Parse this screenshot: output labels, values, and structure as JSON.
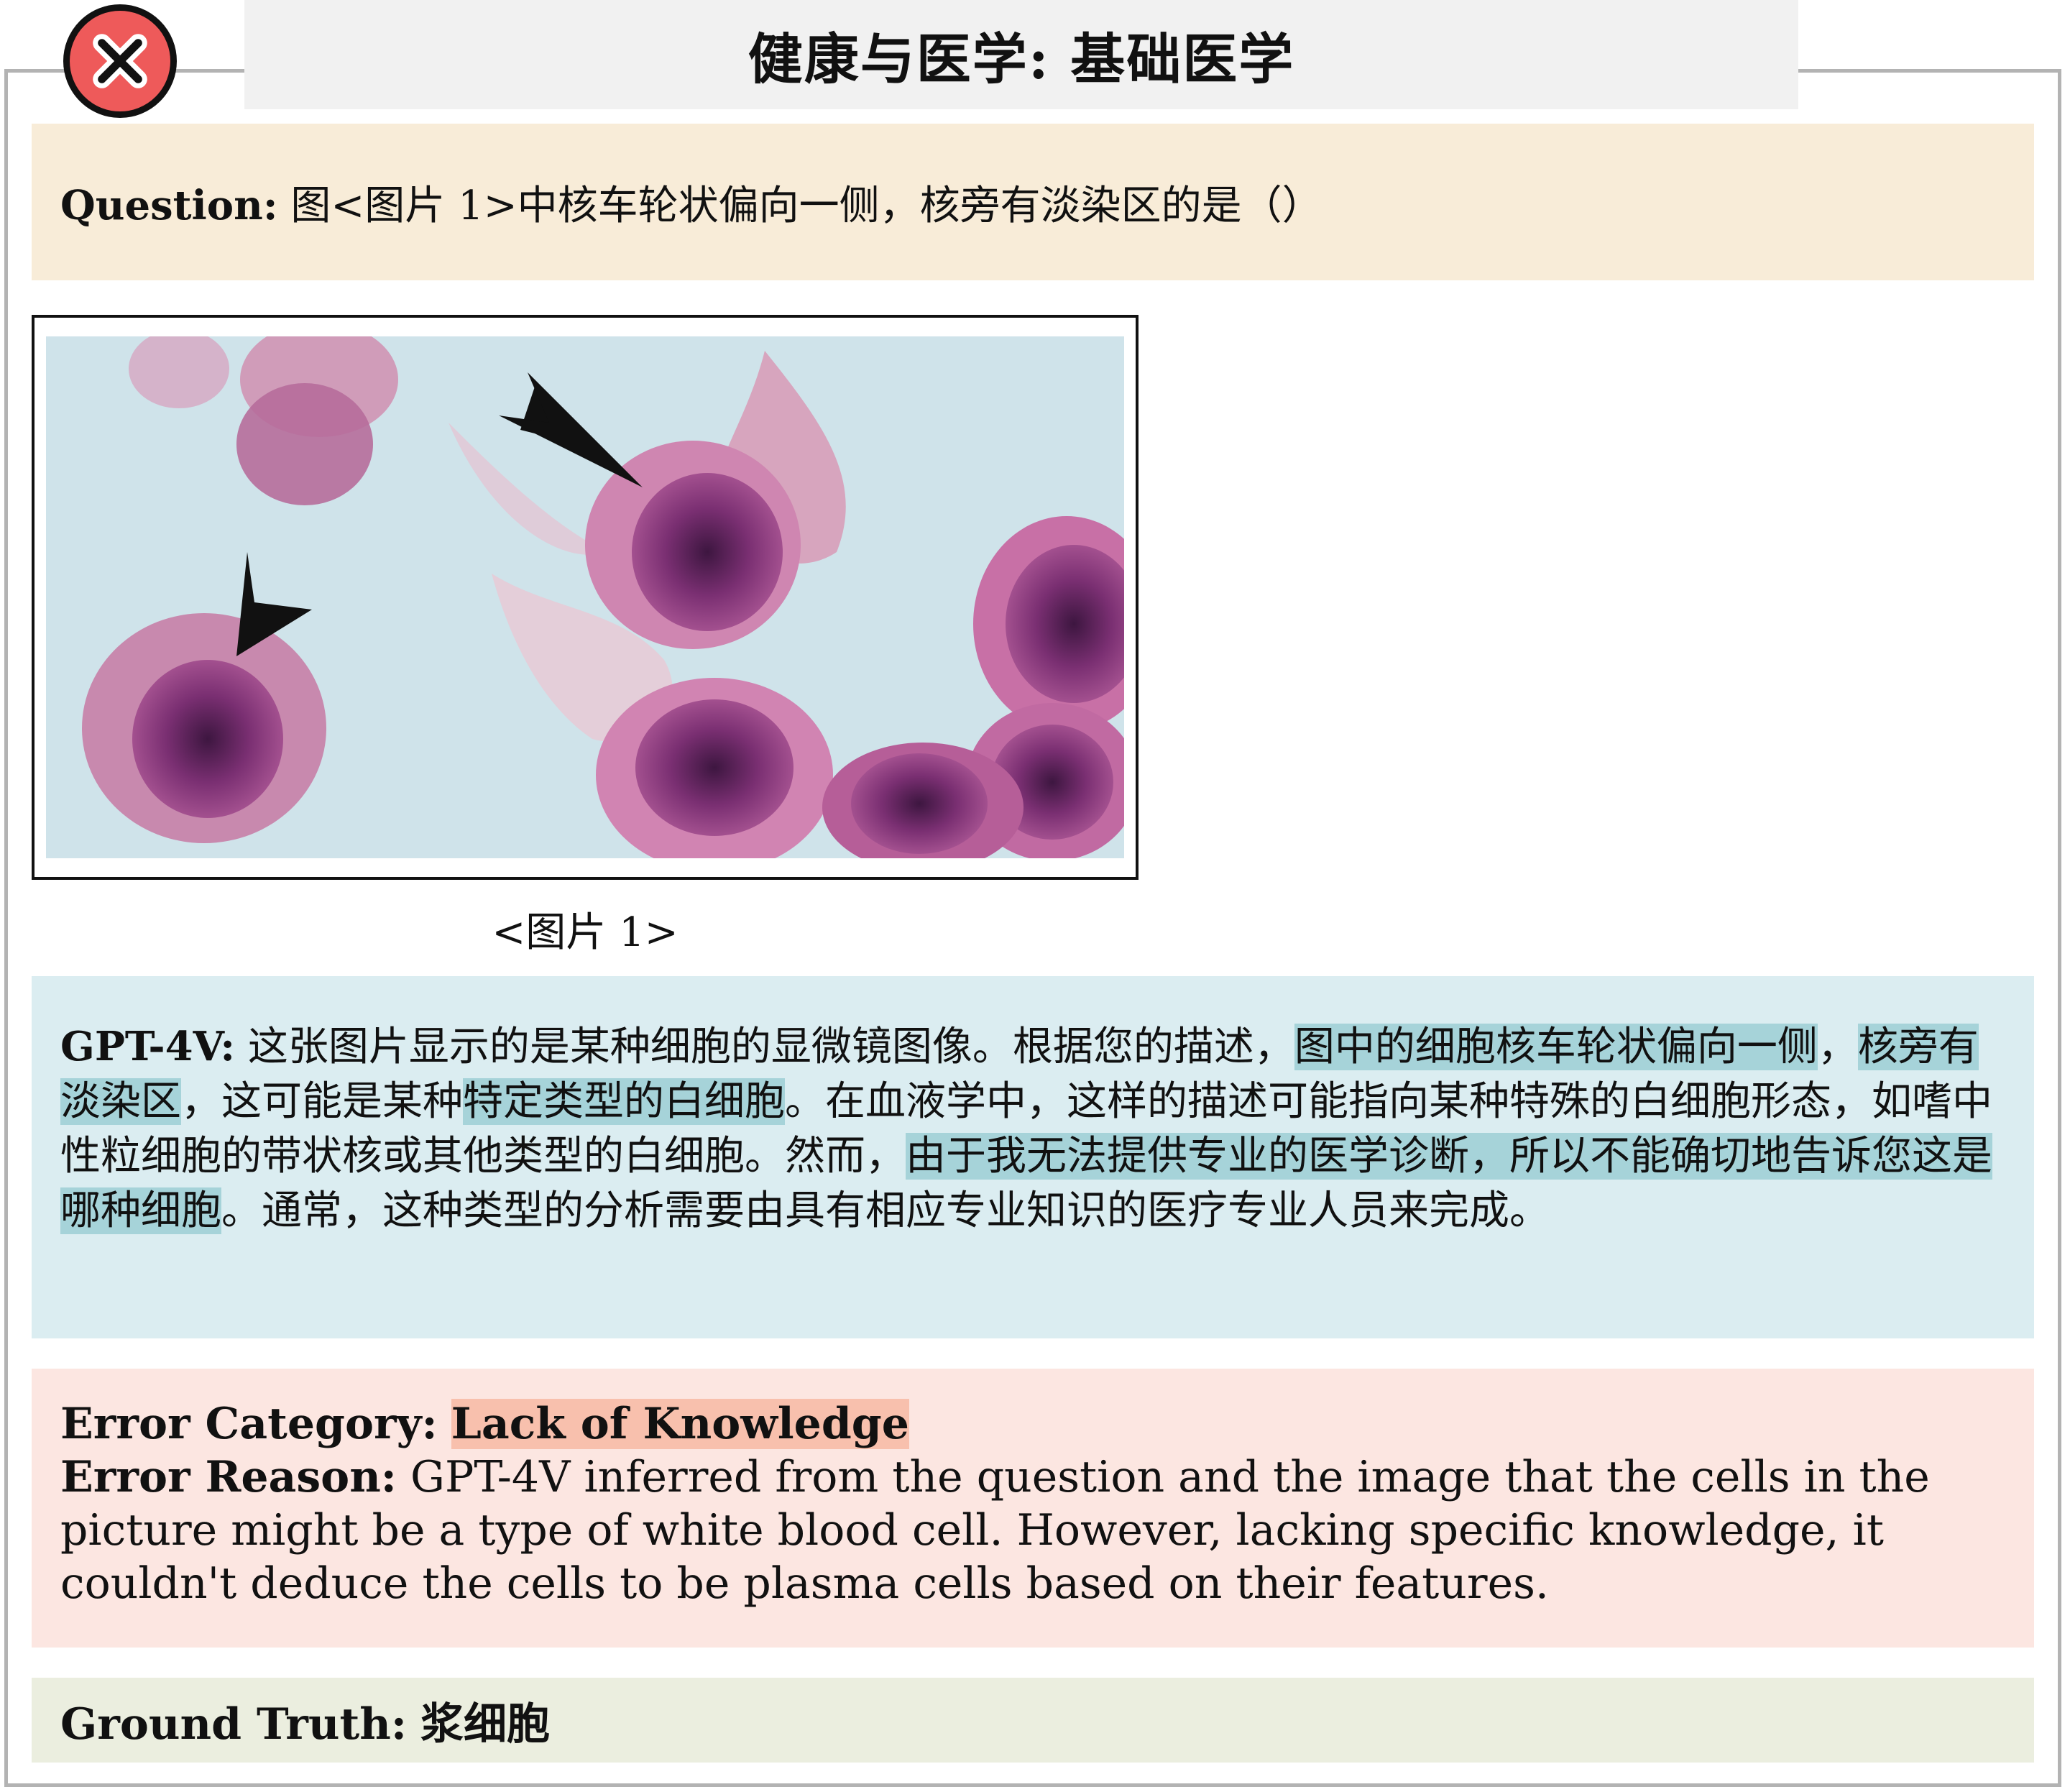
{
  "header": {
    "title": "健康与医学: 基础医学",
    "status_icon": "error-x-icon",
    "status_color": "#ee5a5a"
  },
  "question": {
    "label": "Question:",
    "text": "图<图片 1>中核车轮状偏向一侧，核旁有淡染区的是（）"
  },
  "figure": {
    "caption": "<图片 1>"
  },
  "response": {
    "label": "GPT-4V:",
    "segments": [
      {
        "text": "这张图片显示的是某种细胞的显微镜图像。根据您的描述，",
        "highlight": false
      },
      {
        "text": "图中的细胞核车轮状偏向一侧",
        "highlight": true
      },
      {
        "text": "，",
        "highlight": false
      },
      {
        "text": "核旁有淡染区",
        "highlight": true
      },
      {
        "text": "，这可能是某种",
        "highlight": false
      },
      {
        "text": "特定类型的白细胞",
        "highlight": true
      },
      {
        "text": "。在血液学中，这样的描述可能指向某种特殊的白细胞形态，如嗜中性粒细胞的带状核或其他类型的白细胞。然而，",
        "highlight": false
      },
      {
        "text": "由于我无法提供专业的医学诊断，所以不能确切地告诉您这是哪种细胞",
        "highlight": true
      },
      {
        "text": "。通常，这种类型的分析需要由具有相应专业知识的医疗专业人员来完成。",
        "highlight": false
      }
    ]
  },
  "error": {
    "category_label": "Error Category:",
    "category_value": "Lack of Knowledge",
    "reason_label": "Error Reason:",
    "reason_text": "GPT-4V inferred from the question and the image that the cells in the picture might be a type of white blood cell. However, lacking specific knowledge, it couldn't deduce the cells to be plasma cells based on their features."
  },
  "ground_truth": {
    "label": "Ground Truth:",
    "value": "浆细胞"
  },
  "colors": {
    "question_bg": "#f8ecd8",
    "response_bg": "#dbedf1",
    "error_bg": "#fce6e1",
    "ground_truth_bg": "#ebeedf",
    "highlight": "#a6d3d9",
    "category_highlight": "#f8c0ad"
  }
}
